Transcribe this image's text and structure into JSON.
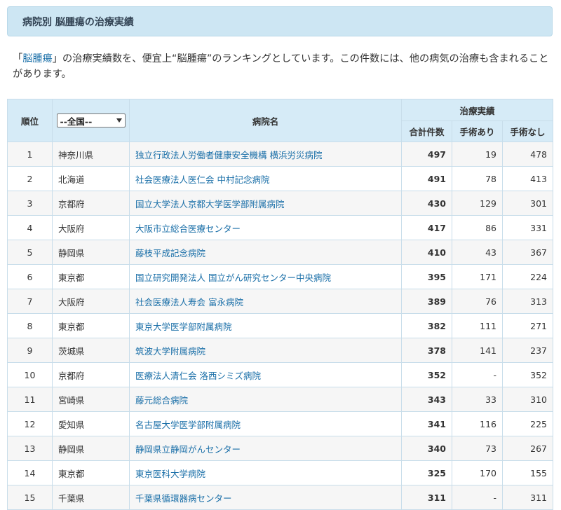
{
  "page": {
    "heading": "病院別 脳腫瘍の治療実績",
    "intro": {
      "open_quote": "「",
      "keyword": "脳腫瘍",
      "text_after_keyword": "」の治療実績数を、便宜上“脳腫瘍”のランキングとしています。この件数には、他の病気の治療も含まれることがあります。"
    }
  },
  "table": {
    "headers": {
      "rank": "順位",
      "region_filter": "--全国--",
      "hospital": "病院名",
      "results_group": "治療実績",
      "total": "合計件数",
      "with_surgery": "手術あり",
      "without_surgery": "手術なし"
    },
    "rows": [
      {
        "rank": "1",
        "pref": "神奈川県",
        "name": "独立行政法人労働者健康安全機構 横浜労災病院",
        "total": "497",
        "surgery": "19",
        "no_surgery": "478"
      },
      {
        "rank": "2",
        "pref": "北海道",
        "name": "社会医療法人医仁会 中村記念病院",
        "total": "491",
        "surgery": "78",
        "no_surgery": "413"
      },
      {
        "rank": "3",
        "pref": "京都府",
        "name": "国立大学法人京都大学医学部附属病院",
        "total": "430",
        "surgery": "129",
        "no_surgery": "301"
      },
      {
        "rank": "4",
        "pref": "大阪府",
        "name": "大阪市立総合医療センター",
        "total": "417",
        "surgery": "86",
        "no_surgery": "331"
      },
      {
        "rank": "5",
        "pref": "静岡県",
        "name": "藤枝平成記念病院",
        "total": "410",
        "surgery": "43",
        "no_surgery": "367"
      },
      {
        "rank": "6",
        "pref": "東京都",
        "name": "国立研究開発法人 国立がん研究センター中央病院",
        "total": "395",
        "surgery": "171",
        "no_surgery": "224"
      },
      {
        "rank": "7",
        "pref": "大阪府",
        "name": "社会医療法人寿会 富永病院",
        "total": "389",
        "surgery": "76",
        "no_surgery": "313"
      },
      {
        "rank": "8",
        "pref": "東京都",
        "name": "東京大学医学部附属病院",
        "total": "382",
        "surgery": "111",
        "no_surgery": "271"
      },
      {
        "rank": "9",
        "pref": "茨城県",
        "name": "筑波大学附属病院",
        "total": "378",
        "surgery": "141",
        "no_surgery": "237"
      },
      {
        "rank": "10",
        "pref": "京都府",
        "name": "医療法人清仁会 洛西シミズ病院",
        "total": "352",
        "surgery": "-",
        "no_surgery": "352"
      },
      {
        "rank": "11",
        "pref": "宮崎県",
        "name": "藤元総合病院",
        "total": "343",
        "surgery": "33",
        "no_surgery": "310"
      },
      {
        "rank": "12",
        "pref": "愛知県",
        "name": "名古屋大学医学部附属病院",
        "total": "341",
        "surgery": "116",
        "no_surgery": "225"
      },
      {
        "rank": "13",
        "pref": "静岡県",
        "name": "静岡県立静岡がんセンター",
        "total": "340",
        "surgery": "73",
        "no_surgery": "267"
      },
      {
        "rank": "14",
        "pref": "東京都",
        "name": "東京医科大学病院",
        "total": "325",
        "surgery": "170",
        "no_surgery": "155"
      },
      {
        "rank": "15",
        "pref": "千葉県",
        "name": "千葉県循環器病センター",
        "total": "311",
        "surgery": "-",
        "no_surgery": "311"
      }
    ]
  },
  "colors": {
    "header_bar_bg": "#cde6f3",
    "table_header_bg": "#d6ebf7",
    "link": "#1a6fa8",
    "row_alt_bg": "#f6f6f6"
  }
}
